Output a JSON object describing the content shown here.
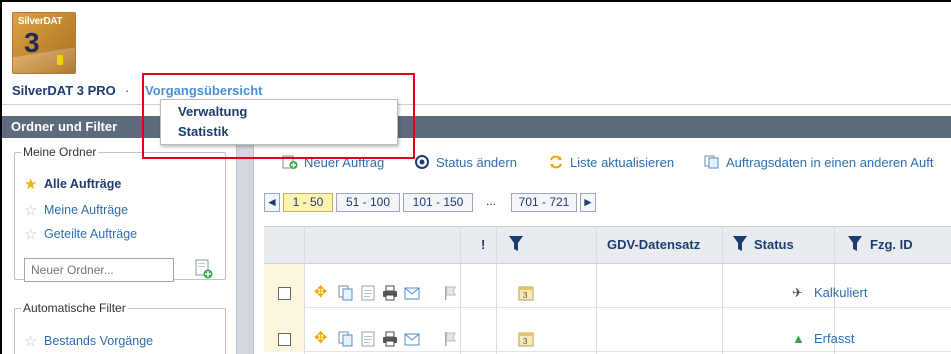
{
  "app": {
    "logo_text": "SilverDAT",
    "logo_number": "3"
  },
  "breadcrumb": {
    "app_name": "SilverDAT 3 PRO",
    "separator": "·",
    "current": "Vorgangsübersicht"
  },
  "dropdown": {
    "items": [
      "Verwaltung",
      "Statistik"
    ]
  },
  "left_panel": {
    "title": "Ordner und Filter",
    "my_folders_legend": "Meine Ordner",
    "my_folders": [
      {
        "label": "Alle Aufträge",
        "active": true
      },
      {
        "label": "Meine Aufträge",
        "active": false
      },
      {
        "label": "Geteilte Aufträge",
        "active": false
      }
    ],
    "new_folder_placeholder": "Neuer Ordner...",
    "auto_filter_legend": "Automatische Filter",
    "auto_filters": [
      {
        "label": "Bestands Vorgänge"
      }
    ]
  },
  "toolbar": {
    "new_order": "Neuer Auftrag",
    "change_status": "Status ändern",
    "refresh_list": "Liste aktualisieren",
    "copy_order": "Auftragsdaten in einen anderen Auft"
  },
  "pagination": {
    "prev": "◄",
    "next": "►",
    "pages": [
      "1 - 50",
      "51 - 100",
      "101 - 150"
    ],
    "ellipsis": "...",
    "last_page": "701 - 721",
    "active_index": 0
  },
  "table": {
    "headers": {
      "flag": "!",
      "gdv": "GDV-Datensatz",
      "status": "Status",
      "vehicle_id": "Fzg. ID"
    },
    "rows": [
      {
        "status": "Kalkuliert"
      },
      {
        "status": "Erfasst"
      }
    ]
  },
  "colors": {
    "accent": "#2e6fb0",
    "highlight_box": "#e2001a",
    "panel_header": "#5e6b7d"
  }
}
